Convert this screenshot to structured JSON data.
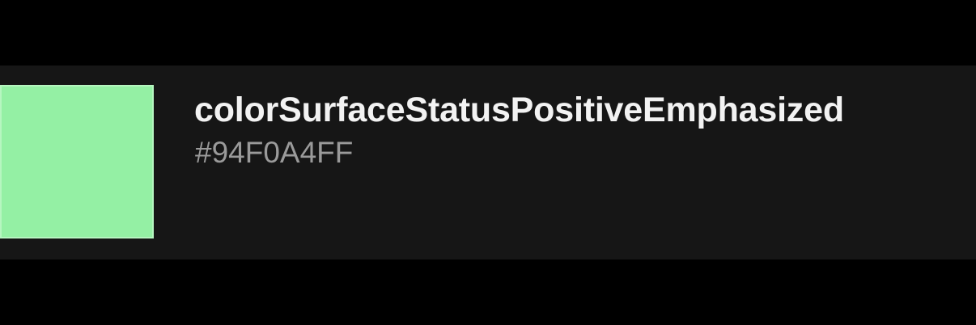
{
  "token": {
    "name": "colorSurfaceStatusPositiveEmphasized",
    "hex": "#94F0A4FF",
    "swatch_color": "#94F0A4"
  },
  "colors": {
    "background": "#000000",
    "card": "#161616",
    "name_text": "#F2F2F2",
    "hex_text": "#9A9A9A"
  }
}
